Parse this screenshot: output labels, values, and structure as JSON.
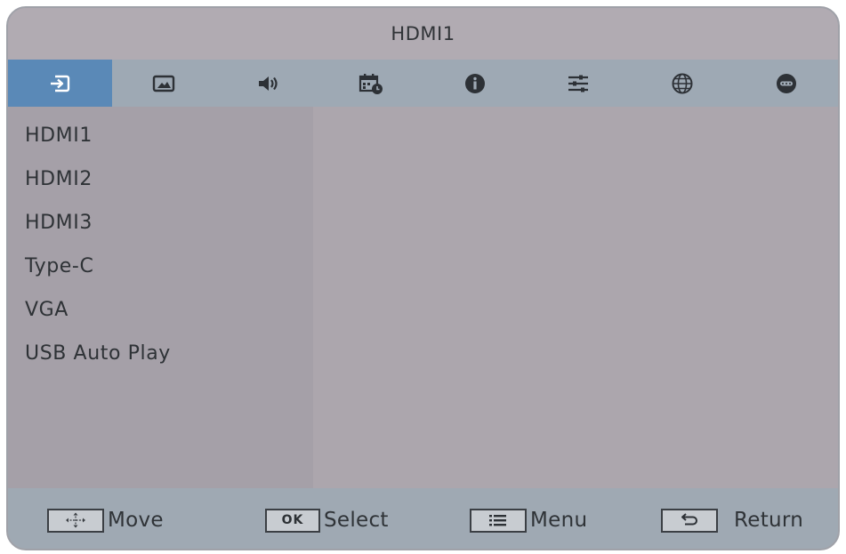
{
  "title": "HDMI1",
  "colors": {
    "active_tab": "#5a89b7",
    "tab_bar": "#9ea9b4",
    "panel": "#aca6ad",
    "footer": "#9fa9b3"
  },
  "tabs": [
    {
      "icon": "input-source-icon",
      "active": true
    },
    {
      "icon": "picture-icon",
      "active": false
    },
    {
      "icon": "speaker-icon",
      "active": false
    },
    {
      "icon": "calendar-clock-icon",
      "active": false
    },
    {
      "icon": "info-icon",
      "active": false
    },
    {
      "icon": "sliders-icon",
      "active": false
    },
    {
      "icon": "globe-icon",
      "active": false
    },
    {
      "icon": "more-icon",
      "active": false
    }
  ],
  "sources": [
    {
      "label": "HDMI1"
    },
    {
      "label": "HDMI2"
    },
    {
      "label": "HDMI3"
    },
    {
      "label": "Type-C"
    },
    {
      "label": "VGA"
    },
    {
      "label": "USB Auto Play"
    }
  ],
  "footer": {
    "move": {
      "label": "Move",
      "key_icon": "directional-pad-icon"
    },
    "select": {
      "label": "Select",
      "key_text": "OK"
    },
    "menu": {
      "label": "Menu",
      "key_icon": "list-icon"
    },
    "return": {
      "label": "Return",
      "key_icon": "return-arrow-icon"
    }
  }
}
